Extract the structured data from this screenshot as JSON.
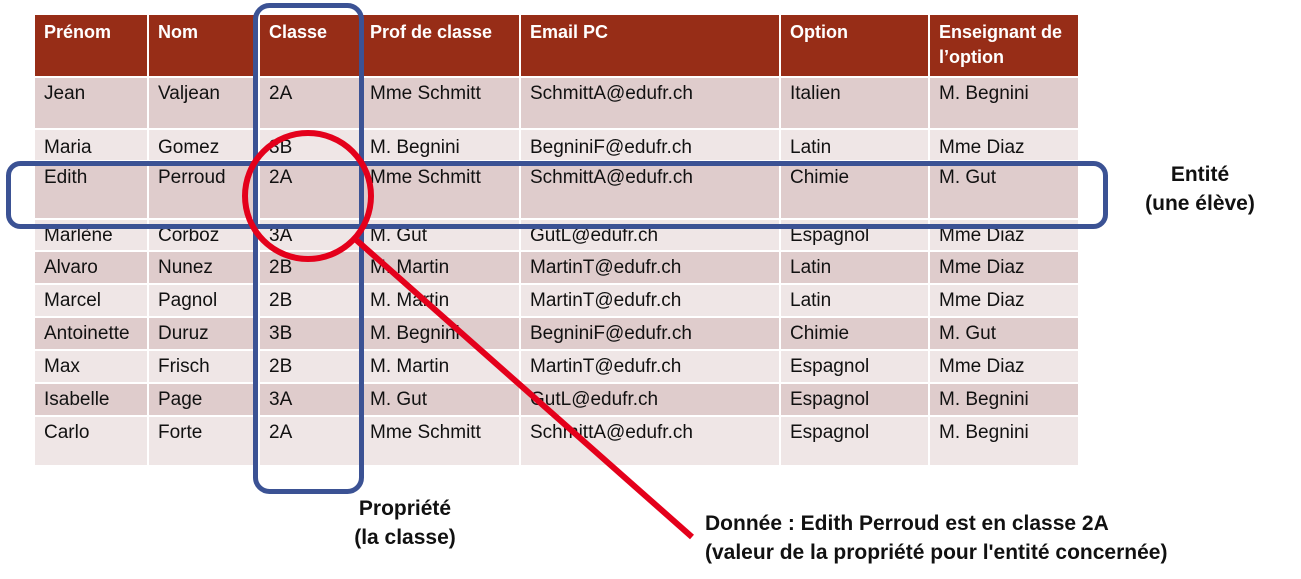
{
  "table": {
    "headers": [
      "Prénom",
      "Nom",
      "Classe",
      "Prof de classe",
      "Email PC",
      "Option",
      "Enseignant de l’option"
    ],
    "rows": [
      [
        "Jean",
        "Valjean",
        "2A",
        "Mme Schmitt",
        "SchmittA@edufr.ch",
        "Italien",
        "M. Begnini"
      ],
      [
        "Maria",
        "Gomez",
        "3B",
        "M. Begnini",
        "BegniniF@edufr.ch",
        "Latin",
        "Mme Diaz"
      ],
      [
        "Edith",
        "Perroud",
        "2A",
        "Mme Schmitt",
        "SchmittA@edufr.ch",
        "Chimie",
        "M. Gut"
      ],
      [
        "Marlène",
        "Corboz",
        "3A",
        "M. Gut",
        "GutL@edufr.ch",
        "Espagnol",
        "Mme Diaz"
      ],
      [
        "Alvaro",
        "Nunez",
        "2B",
        "M. Martin",
        "MartinT@edufr.ch",
        "Latin",
        "Mme Diaz"
      ],
      [
        "Marcel",
        "Pagnol",
        "2B",
        "M. Martin",
        "MartinT@edufr.ch",
        "Latin",
        "Mme Diaz"
      ],
      [
        "Antoinette",
        "Duruz",
        "3B",
        "M. Begnini",
        "BegniniF@edufr.ch",
        "Chimie",
        "M. Gut"
      ],
      [
        "Max",
        "Frisch",
        "2B",
        "M. Martin",
        "MartinT@edufr.ch",
        "Espagnol",
        "Mme Diaz"
      ],
      [
        "Isabelle",
        "Page",
        "3A",
        "M. Gut",
        "GutL@edufr.ch",
        "Espagnol",
        "M. Begnini"
      ],
      [
        "Carlo",
        "Forte",
        "2A",
        "Mme Schmitt",
        "SchmittA@edufr.ch",
        "Espagnol",
        "M. Begnini"
      ]
    ]
  },
  "annotations": {
    "entity": {
      "line1": "Entité",
      "line2": "(une élève)"
    },
    "property": {
      "line1": "Propriété",
      "line2": "(la classe)"
    },
    "datum": {
      "line1": "Donnée : Edith Perroud est en classe 2A",
      "line2": "(valeur de la propriété pour l'entité concernée)"
    }
  },
  "colors": {
    "header_bg": "#972d17",
    "row_odd_bg": "#dfcccc",
    "row_even_bg": "#efe6e6",
    "highlight_box": "#3b5294",
    "highlight_circle": "#e4001b"
  }
}
